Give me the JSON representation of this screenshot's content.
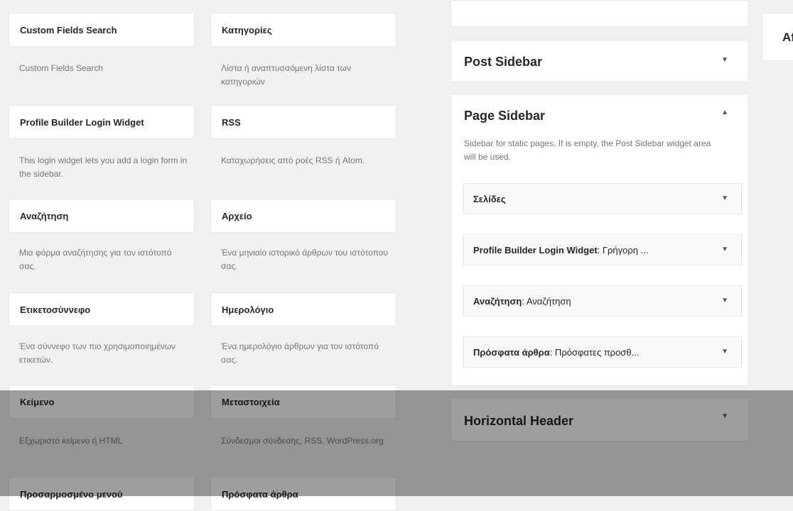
{
  "available_widgets": [
    {
      "title": "Custom Fields Search",
      "desc": "Custom Fields Search"
    },
    {
      "title": "Κατηγορίες",
      "desc": "Λίστα ή αναπτυσσόμενη λίστα των κατηγοριών"
    },
    {
      "title": "Profile Builder Login Widget",
      "desc": "This login widget lets you add a login form in the sidebar."
    },
    {
      "title": "RSS",
      "desc": "Καταχωρήσεις από ροές RSS ή Atom."
    },
    {
      "title": "Αναζήτηση",
      "desc": "Μια φόρμα αναζήτησης για τον ιστότοπό σας."
    },
    {
      "title": "Αρχείο",
      "desc": "Ένα μηνιαίο ιστορικό άρθρων του ιστότοπου σας."
    },
    {
      "title": "Ετικετοσύννεφο",
      "desc": "Ένα σύννεφο των πιο χρησιμοποιημένων ετικετών."
    },
    {
      "title": "Ημερολόγιο",
      "desc": "Ένα ημερολόγιο άρθρων για τον ιστότοπό σας."
    },
    {
      "title": "Κείμενο",
      "desc": "Εξχωριστό κείμενο ή HTML"
    },
    {
      "title": "Μεταστοιχεία",
      "desc": "Σύνδεσμοι σύνδεσης, RSS, WordPress.org"
    },
    {
      "title": "Προσαρμοσμένο μενού",
      "desc": ""
    },
    {
      "title": "Πρόσφατα άρθρα",
      "desc": ""
    }
  ],
  "sidebars": {
    "post_sidebar": {
      "title": "Post Sidebar"
    },
    "page_sidebar": {
      "title": "Page Sidebar",
      "description": "Sidebar for static pages. If is empty, the Post Sidebar widget area will be used.",
      "widgets": [
        {
          "name": "Σελίδες",
          "subtitle": ""
        },
        {
          "name": "Profile Builder Login Widget",
          "subtitle": ": Γρήγορη ..."
        },
        {
          "name": "Αναζήτηση",
          "subtitle": ": Αναζήτηση"
        },
        {
          "name": "Πρόσφατα άρθρα",
          "subtitle": ": Πρόσφατες προσθ..."
        }
      ]
    },
    "horizontal_header": {
      "title": "Horizontal Header"
    }
  },
  "right_panel": {
    "title": "Af"
  },
  "icons": {
    "collapse": "▼",
    "expand": "▲"
  }
}
